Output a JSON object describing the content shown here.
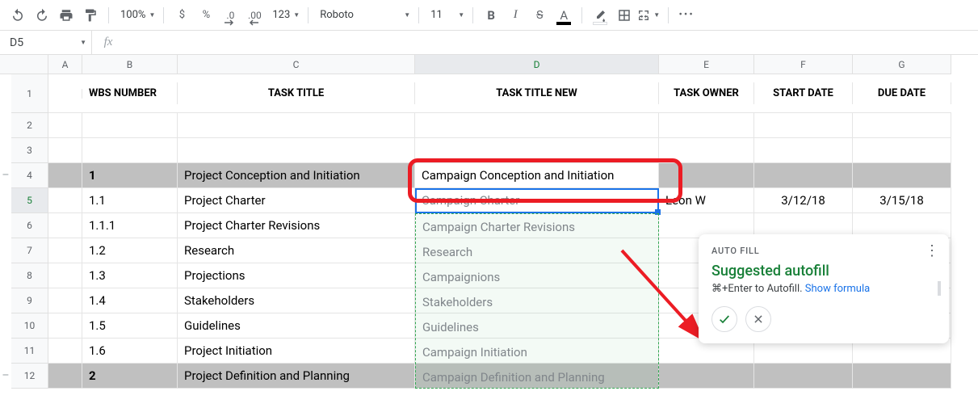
{
  "toolbar": {
    "zoom": "100%",
    "currency": "$",
    "percent": "%",
    "dec_dec": ".0",
    "dec_inc": ".00",
    "format123": "123",
    "font": "Roboto",
    "fontsize": "11"
  },
  "formula": {
    "namebox": "D5",
    "fx": "fx",
    "value": ""
  },
  "columns": [
    "A",
    "B",
    "C",
    "D",
    "E",
    "F",
    "G"
  ],
  "rownums": [
    "1",
    "2",
    "3",
    "4",
    "5",
    "6",
    "7",
    "8",
    "9",
    "10",
    "11",
    "12"
  ],
  "headers": {
    "b": "WBS NUMBER",
    "c": "TASK TITLE",
    "d": "TASK TITLE NEW",
    "e": "TASK OWNER",
    "f": "START DATE",
    "g": "DUE DATE"
  },
  "rows": [
    {
      "b": "1",
      "c": "Project Conception and Initiation",
      "d": "Campaign Conception and Initiation",
      "e": "",
      "f": "",
      "g": "",
      "section": true
    },
    {
      "b": "1.1",
      "c": "Project Charter",
      "d": "Campaign Charter",
      "e": "Leon W",
      "f": "3/12/18",
      "g": "3/15/18",
      "section": false
    },
    {
      "b": "1.1.1",
      "c": "Project Charter Revisions",
      "d": "Campaign Charter Revisions",
      "e": "",
      "f": "",
      "g": "",
      "section": false
    },
    {
      "b": "1.2",
      "c": "Research",
      "d": "Research",
      "e": "",
      "f": "",
      "g": "",
      "section": false
    },
    {
      "b": "1.3",
      "c": "Projections",
      "d": "Campaignions",
      "e": "",
      "f": "",
      "g": "",
      "section": false
    },
    {
      "b": "1.4",
      "c": "Stakeholders",
      "d": "Stakeholders",
      "e": "",
      "f": "",
      "g": "",
      "section": false
    },
    {
      "b": "1.5",
      "c": "Guidelines",
      "d": "Guidelines",
      "e": "",
      "f": "",
      "g": "",
      "section": false
    },
    {
      "b": "1.6",
      "c": "Project Initiation",
      "d": "Campaign Initiation",
      "e": "",
      "f": "",
      "g": "",
      "section": false
    },
    {
      "b": "2",
      "c": "Project Definition and Planning",
      "d": "Campaign Definition and Planning",
      "e": "",
      "f": "",
      "g": "",
      "section": true
    }
  ],
  "popup": {
    "title": "AUTO FILL",
    "suggested": "Suggested autofill",
    "hint_prefix": "⌘+Enter to Autofill. ",
    "show_formula": "Show formula"
  }
}
